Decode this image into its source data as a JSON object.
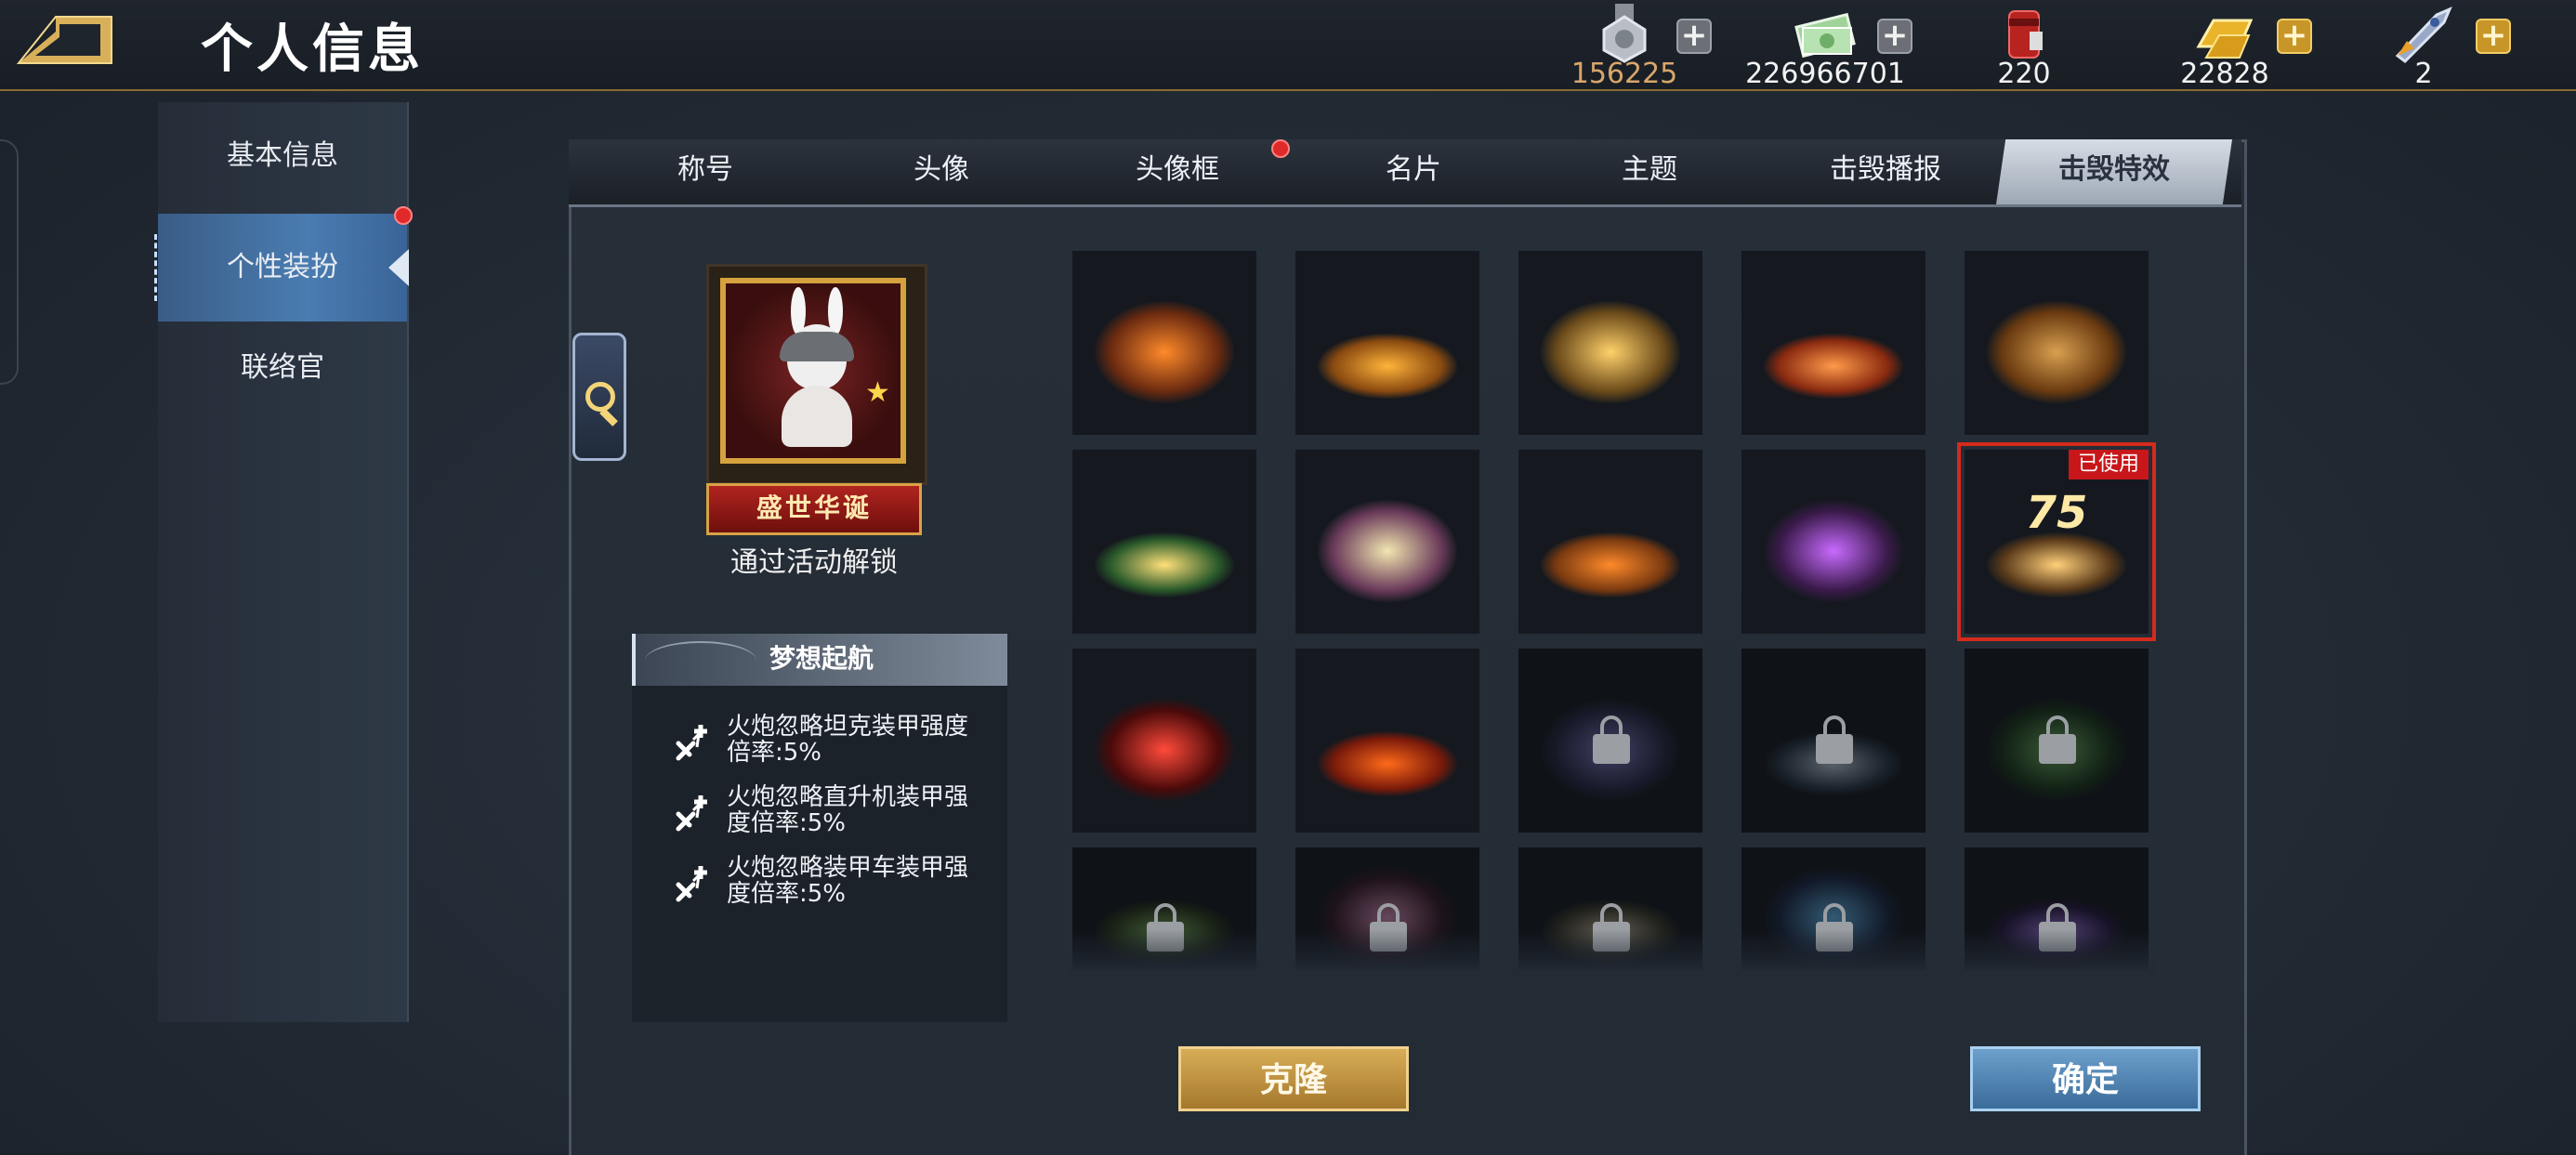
{
  "header": {
    "title": "个人信息"
  },
  "resources": [
    {
      "icon": "medal-icon",
      "value": "156225",
      "plus": "+",
      "plus_style": "grey",
      "value_color": "#d9a66a"
    },
    {
      "icon": "cash-icon",
      "value": "226966701",
      "plus": "+",
      "plus_style": "grey",
      "value_color": "#f2f2f2"
    },
    {
      "icon": "paint-bucket-icon",
      "value": "220",
      "plus": "",
      "plus_style": "none",
      "value_color": "#f2f2f2"
    },
    {
      "icon": "gold-bar-icon",
      "value": "22828",
      "plus": "+",
      "plus_style": "gold",
      "value_color": "#f2f2f2"
    },
    {
      "icon": "rocket-icon",
      "value": "2",
      "plus": "+",
      "plus_style": "gold",
      "value_color": "#f2f2f2"
    }
  ],
  "sidebar": {
    "items": [
      {
        "label": "基本信息",
        "active": false
      },
      {
        "label": "个性装扮",
        "active": true,
        "notification": true
      },
      {
        "label": "联络官",
        "active": false
      }
    ]
  },
  "tabs": [
    {
      "label": "称号",
      "active": false
    },
    {
      "label": "头像",
      "active": false
    },
    {
      "label": "头像框",
      "active": false,
      "notification": true
    },
    {
      "label": "名片",
      "active": false
    },
    {
      "label": "主题",
      "active": false
    },
    {
      "label": "击毁播报",
      "active": false
    },
    {
      "label": "击毁特效",
      "active": true
    }
  ],
  "preview": {
    "banner": "盛世华诞",
    "unlock_text": "通过活动解锁"
  },
  "info": {
    "name": "梦想起航",
    "attributes": [
      {
        "line1": "火炮忽略坦克装甲强度",
        "line2": "倍率:5%"
      },
      {
        "line1": "火炮忽略直升机装甲强",
        "line2": "度倍率:5%"
      },
      {
        "line1": "火炮忽略装甲车装甲强",
        "line2": "度倍率:5%"
      }
    ]
  },
  "effects": [
    {
      "name": "explosion-effect",
      "locked": false,
      "colors": [
        "#ff8a2a",
        "#6a2a10"
      ]
    },
    {
      "name": "gold-coin-ring-effect",
      "locked": false,
      "colors": [
        "#ffb43a",
        "#8a4a10"
      ]
    },
    {
      "name": "number-three-ring-effect",
      "locked": false,
      "colors": [
        "#ffd16a",
        "#6a4a1a"
      ]
    },
    {
      "name": "fire-ring-effect",
      "locked": false,
      "colors": [
        "#ff9a4a",
        "#8a2a10"
      ]
    },
    {
      "name": "wooden-bowl-effect",
      "locked": false,
      "colors": [
        "#d8a050",
        "#6a3a10"
      ]
    },
    {
      "name": "christmas-tree-effect",
      "locked": false,
      "colors": [
        "#ffe07a",
        "#2a5a2a"
      ]
    },
    {
      "name": "bunny-flower-effect",
      "locked": false,
      "colors": [
        "#f2e6b0",
        "#6a3a5a"
      ]
    },
    {
      "name": "stage-ring-effect",
      "locked": false,
      "colors": [
        "#ff8a2a",
        "#7a3a10"
      ]
    },
    {
      "name": "purple-sparkle-effect",
      "locked": false,
      "colors": [
        "#c86aff",
        "#3a1a4a"
      ]
    },
    {
      "name": "anniversary-cake-effect",
      "locked": false,
      "colors": [
        "#ffd07a",
        "#5a3a1a"
      ],
      "selected": true,
      "tag": "已使用",
      "text": "75"
    },
    {
      "name": "neon-sign-effect",
      "locked": false,
      "colors": [
        "#ff4a3a",
        "#4a0a0a"
      ]
    },
    {
      "name": "fire-flower-effect",
      "locked": false,
      "colors": [
        "#ff6a1a",
        "#7a1a0a"
      ]
    },
    {
      "name": "blue-ring-locked-effect",
      "locked": true,
      "colors": [
        "#8a8ad8",
        "#2a2a4a"
      ]
    },
    {
      "name": "snowflake-locked-effect",
      "locked": true,
      "colors": [
        "#c8d8e8",
        "#2a3a4a"
      ]
    },
    {
      "name": "green-shield-locked-effect",
      "locked": true,
      "colors": [
        "#7ac86a",
        "#1a3a1a"
      ]
    },
    {
      "name": "green-vine-locked-effect",
      "locked": true,
      "colors": [
        "#8ac86a",
        "#2a3a1a"
      ]
    },
    {
      "name": "pink-heart-locked-effect",
      "locked": true,
      "colors": [
        "#e89ac8",
        "#3a1a2a"
      ]
    },
    {
      "name": "silver-coin-locked-effect",
      "locked": true,
      "colors": [
        "#d8c8a8",
        "#3a3a2a"
      ]
    },
    {
      "name": "blue-star-locked-effect",
      "locked": true,
      "colors": [
        "#6ac8ff",
        "#1a2a4a"
      ]
    },
    {
      "name": "purple-moon-locked-effect",
      "locked": true,
      "colors": [
        "#b88aff",
        "#2a1a4a"
      ]
    }
  ],
  "buttons": {
    "clone": "克隆",
    "confirm": "确定"
  }
}
